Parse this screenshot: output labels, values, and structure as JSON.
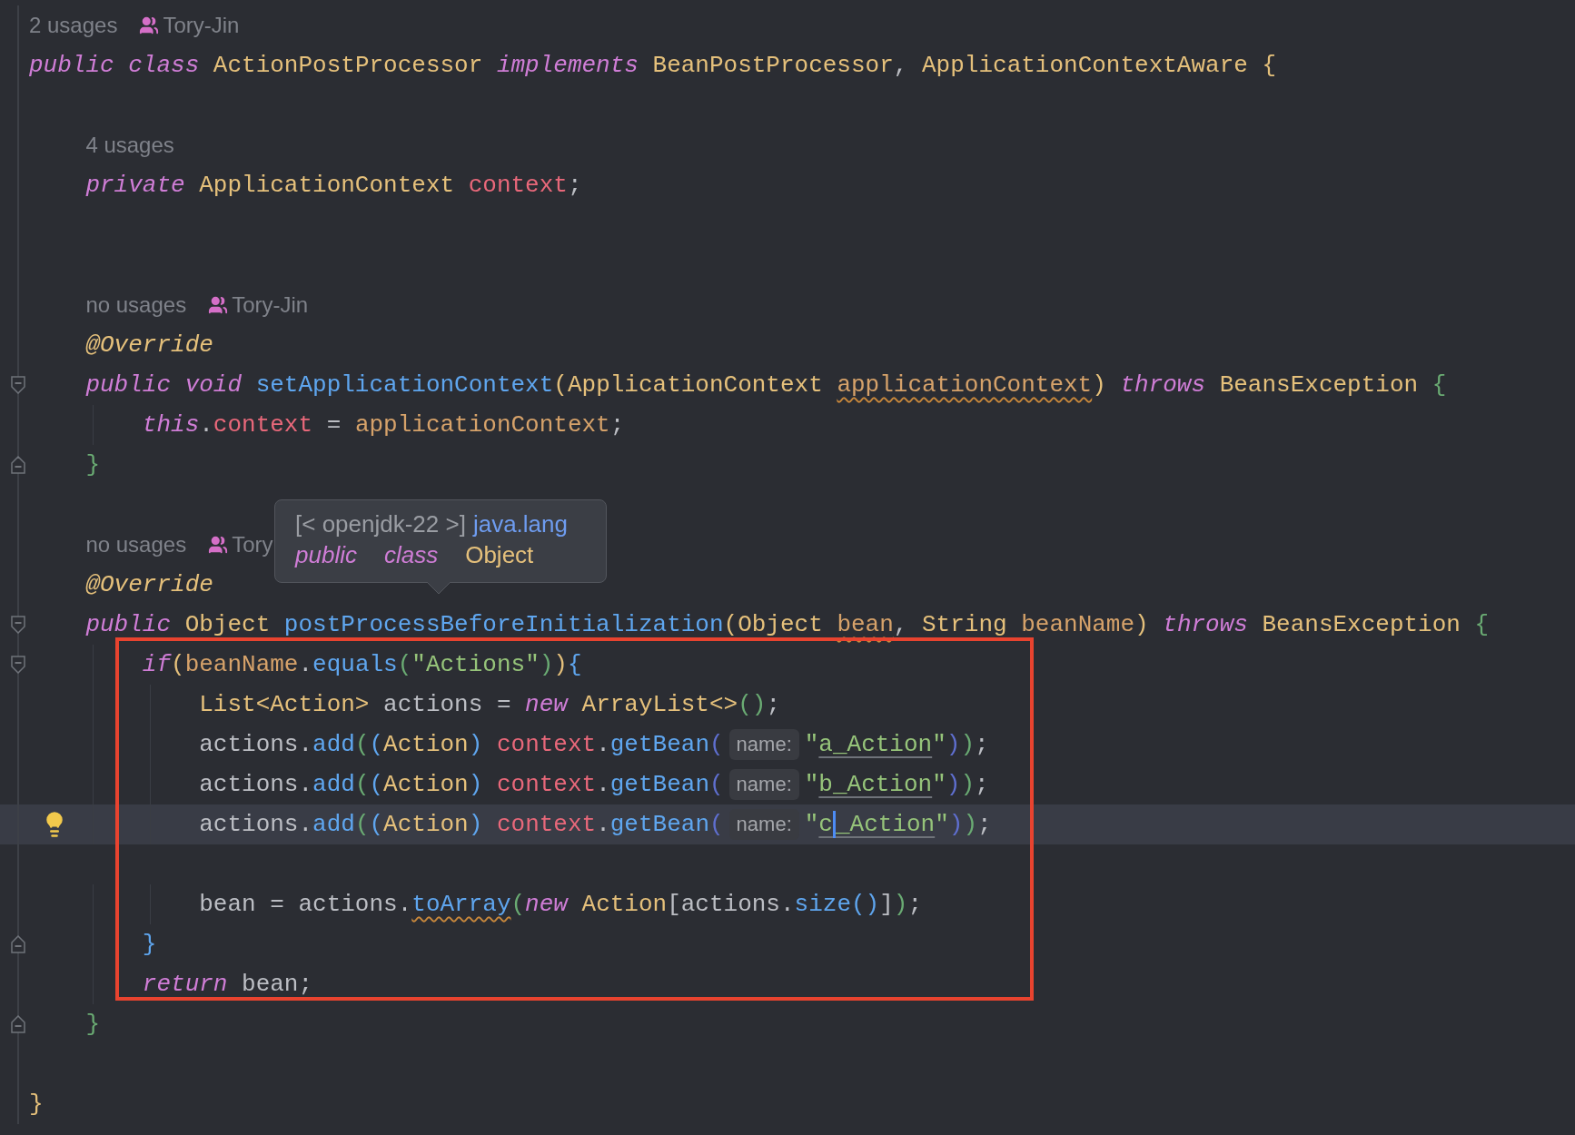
{
  "sections": [
    {
      "kind": "plain",
      "lines": [
        {
          "kind": "hint",
          "usages": "2 usages",
          "author": "Tory-Jin"
        },
        {
          "kind": "code",
          "tokens": [
            {
              "text": "public",
              "kind": "kw"
            },
            {
              "text": " class",
              "kind": "kw"
            },
            {
              "text": " ActionPostProcessor ",
              "kind": "type"
            },
            {
              "text": "implements",
              "kind": "kw"
            },
            {
              "text": " BeanPostProcessor",
              "kind": "type"
            },
            {
              "text": ", ",
              "kind": "plain"
            },
            {
              "text": "ApplicationContextAware ",
              "kind": "type"
            },
            {
              "text": "{",
              "kind": "bracket",
              "color": "#e5c07b"
            }
          ]
        },
        {
          "kind": "blank"
        },
        {
          "kind": "hint",
          "usages": "4 usages"
        },
        {
          "kind": "code",
          "tokens": [
            {
              "text": "    private",
              "kind": "kw"
            },
            {
              "text": " ApplicationContext ",
              "kind": "type"
            },
            {
              "text": "context",
              "kind": "field"
            },
            {
              "text": ";",
              "kind": "plain"
            }
          ]
        },
        {
          "kind": "blank"
        },
        {
          "kind": "blank"
        },
        {
          "kind": "hint",
          "usages": "no usages",
          "author": "Tory-Jin"
        },
        {
          "kind": "code",
          "tokens": [
            {
              "text": "    @Override",
              "kind": "annot"
            }
          ]
        },
        {
          "kind": "code",
          "fold_start": true,
          "tokens": [
            {
              "text": "    public",
              "kind": "kw"
            },
            {
              "text": " void",
              "kind": "kw"
            },
            {
              "text": " setApplicationContext",
              "kind": "fn"
            },
            {
              "text": "(",
              "kind": "bracket",
              "color": "#e5c07b"
            },
            {
              "text": "ApplicationContext ",
              "kind": "type"
            },
            {
              "text": "applicationContext",
              "kind": "param",
              "squiggly": true
            },
            {
              "text": ")",
              "kind": "bracket",
              "color": "#e5c07b"
            },
            {
              "text": " throws",
              "kind": "kw"
            },
            {
              "text": " BeansException ",
              "kind": "type"
            },
            {
              "text": "{",
              "kind": "bracket",
              "color": "#6aab73"
            }
          ]
        },
        {
          "kind": "code",
          "tokens": [
            {
              "text": "        this",
              "kind": "kw"
            },
            {
              "text": ".",
              "kind": "plain"
            },
            {
              "text": "context",
              "kind": "field"
            },
            {
              "text": " = ",
              "kind": "plain"
            },
            {
              "text": "applicationContext",
              "kind": "param"
            },
            {
              "text": ";",
              "kind": "plain"
            }
          ]
        },
        {
          "kind": "code",
          "fold_end": true,
          "tokens": [
            {
              "text": "    }",
              "kind": "bracket",
              "color": "#6aab73"
            }
          ]
        },
        {
          "kind": "blank"
        },
        {
          "kind": "hint",
          "usages": "no usages",
          "author": "Tory"
        },
        {
          "kind": "code",
          "tokens": [
            {
              "text": "    @Override",
              "kind": "annot"
            }
          ]
        },
        {
          "kind": "code",
          "fold_start": true,
          "tokens": [
            {
              "text": "    public",
              "kind": "kw"
            },
            {
              "text": " Object ",
              "kind": "type"
            },
            {
              "text": "postProcessBeforeInitialization",
              "kind": "fn"
            },
            {
              "text": "(",
              "kind": "bracket",
              "color": "#e5c07b"
            },
            {
              "text": "Object ",
              "kind": "type"
            },
            {
              "text": "bean",
              "kind": "param",
              "squiggly": true
            },
            {
              "text": ", ",
              "kind": "plain"
            },
            {
              "text": "String ",
              "kind": "type"
            },
            {
              "text": "beanName",
              "kind": "param"
            },
            {
              "text": ")",
              "kind": "bracket",
              "color": "#e5c07b"
            },
            {
              "text": " throws",
              "kind": "kw"
            },
            {
              "text": " BeansException ",
              "kind": "type"
            },
            {
              "text": "{",
              "kind": "bracket",
              "color": "#6aab73"
            }
          ]
        }
      ]
    },
    {
      "kind": "framed",
      "lines": [
        {
          "kind": "code",
          "fold_start": true,
          "tokens": [
            {
              "text": "        if",
              "kind": "kw"
            },
            {
              "text": "(",
              "kind": "bracket",
              "color": "#e5c07b"
            },
            {
              "text": "beanName",
              "kind": "param"
            },
            {
              "text": ".",
              "kind": "plain"
            },
            {
              "text": "equals",
              "kind": "fn"
            },
            {
              "text": "(",
              "kind": "bracket",
              "color": "#6aab73"
            },
            {
              "text": "\"Actions\"",
              "kind": "string"
            },
            {
              "text": ")",
              "kind": "bracket",
              "color": "#6aab73"
            },
            {
              "text": ")",
              "kind": "bracket",
              "color": "#e5c07b"
            },
            {
              "text": "{",
              "kind": "bracket",
              "color": "#5fa6ef"
            }
          ]
        },
        {
          "kind": "code",
          "tokens": [
            {
              "text": "            List<Action>",
              "kind": "type"
            },
            {
              "text": " actions = ",
              "kind": "plain"
            },
            {
              "text": "new",
              "kind": "kw"
            },
            {
              "text": " ArrayList<>",
              "kind": "type"
            },
            {
              "text": "()",
              "kind": "bracket",
              "color": "#6aab73"
            },
            {
              "text": ";",
              "kind": "plain"
            }
          ]
        },
        {
          "kind": "code",
          "tokens": [
            {
              "text": "            actions.",
              "kind": "plain"
            },
            {
              "text": "add",
              "kind": "fn"
            },
            {
              "text": "(",
              "kind": "bracket",
              "color": "#6aab73"
            },
            {
              "text": "(",
              "kind": "bracket",
              "color": "#5fa6ef"
            },
            {
              "text": "Action",
              "kind": "type"
            },
            {
              "text": ")",
              "kind": "bracket",
              "color": "#5fa6ef"
            },
            {
              "text": " context",
              "kind": "field"
            },
            {
              "text": ".",
              "kind": "plain"
            },
            {
              "text": "getBean",
              "kind": "fn"
            },
            {
              "text": "(",
              "kind": "bracket",
              "color": "#5f6fd0"
            },
            {
              "text": "name:",
              "kind": "inlay"
            },
            {
              "text": "\"",
              "kind": "string"
            },
            {
              "text": "a_Action",
              "kind": "string",
              "underlined": true
            },
            {
              "text": "\"",
              "kind": "string"
            },
            {
              "text": ")",
              "kind": "bracket",
              "color": "#5f6fd0"
            },
            {
              "text": ")",
              "kind": "bracket",
              "color": "#6aab73"
            },
            {
              "text": ";",
              "kind": "plain"
            }
          ]
        },
        {
          "kind": "code",
          "tokens": [
            {
              "text": "            actions.",
              "kind": "plain"
            },
            {
              "text": "add",
              "kind": "fn"
            },
            {
              "text": "(",
              "kind": "bracket",
              "color": "#6aab73"
            },
            {
              "text": "(",
              "kind": "bracket",
              "color": "#5fa6ef"
            },
            {
              "text": "Action",
              "kind": "type"
            },
            {
              "text": ")",
              "kind": "bracket",
              "color": "#5fa6ef"
            },
            {
              "text": " context",
              "kind": "field"
            },
            {
              "text": ".",
              "kind": "plain"
            },
            {
              "text": "getBean",
              "kind": "fn"
            },
            {
              "text": "(",
              "kind": "bracket",
              "color": "#5f6fd0"
            },
            {
              "text": "name:",
              "kind": "inlay"
            },
            {
              "text": "\"",
              "kind": "string"
            },
            {
              "text": "b_Action",
              "kind": "string",
              "underlined": true
            },
            {
              "text": "\"",
              "kind": "string"
            },
            {
              "text": ")",
              "kind": "bracket",
              "color": "#5f6fd0"
            },
            {
              "text": ")",
              "kind": "bracket",
              "color": "#6aab73"
            },
            {
              "text": ";",
              "kind": "plain"
            }
          ]
        },
        {
          "kind": "code",
          "current": true,
          "intention": true,
          "tokens": [
            {
              "text": "            actions.",
              "kind": "plain"
            },
            {
              "text": "add",
              "kind": "fn"
            },
            {
              "text": "(",
              "kind": "bracket",
              "color": "#6aab73"
            },
            {
              "text": "(",
              "kind": "bracket",
              "color": "#5fa6ef"
            },
            {
              "text": "Action",
              "kind": "type"
            },
            {
              "text": ")",
              "kind": "bracket",
              "color": "#5fa6ef"
            },
            {
              "text": " context",
              "kind": "field"
            },
            {
              "text": ".",
              "kind": "plain"
            },
            {
              "text": "getBean",
              "kind": "fn"
            },
            {
              "text": "(",
              "kind": "bracket",
              "color": "#5f6fd0"
            },
            {
              "text": "name:",
              "kind": "inlay"
            },
            {
              "text": "\"",
              "kind": "string"
            },
            {
              "text": "c",
              "kind": "string",
              "underlined": true
            },
            {
              "kind": "caret"
            },
            {
              "text": "_Action",
              "kind": "string",
              "underlined": true
            },
            {
              "text": "\"",
              "kind": "string"
            },
            {
              "text": ")",
              "kind": "bracket",
              "color": "#5f6fd0"
            },
            {
              "text": ")",
              "kind": "bracket",
              "color": "#6aab73"
            },
            {
              "text": ";",
              "kind": "plain"
            }
          ]
        },
        {
          "kind": "blank"
        },
        {
          "kind": "code",
          "tokens": [
            {
              "text": "            bean = actions.",
              "kind": "plain"
            },
            {
              "text": "toArray",
              "kind": "fn",
              "squiggly": true
            },
            {
              "text": "(",
              "kind": "bracket",
              "color": "#6aab73"
            },
            {
              "text": "new",
              "kind": "kw"
            },
            {
              "text": " Action",
              "kind": "type"
            },
            {
              "text": "[actions.",
              "kind": "plain"
            },
            {
              "text": "size",
              "kind": "fn"
            },
            {
              "text": "()",
              "kind": "bracket",
              "color": "#5fa6ef"
            },
            {
              "text": "]",
              "kind": "plain"
            },
            {
              "text": ")",
              "kind": "bracket",
              "color": "#6aab73"
            },
            {
              "text": ";",
              "kind": "plain"
            }
          ]
        },
        {
          "kind": "code",
          "fold_end": true,
          "tokens": [
            {
              "text": "        }",
              "kind": "bracket",
              "color": "#5fa6ef"
            }
          ]
        },
        {
          "kind": "code",
          "tokens": [
            {
              "text": "        return",
              "kind": "kw"
            },
            {
              "text": " bean;",
              "kind": "plain"
            }
          ]
        }
      ]
    },
    {
      "kind": "plain",
      "lines": [
        {
          "kind": "code",
          "fold_end": true,
          "tokens": [
            {
              "text": "    }",
              "kind": "bracket",
              "color": "#6aab73"
            }
          ]
        },
        {
          "kind": "blank"
        },
        {
          "kind": "code",
          "tokens": [
            {
              "text": "}",
              "kind": "bracket",
              "color": "#e5c07b"
            }
          ]
        }
      ]
    }
  ],
  "tooltip": {
    "origin": "[< openjdk-22 >]",
    "package": "java.lang",
    "declaration": [
      {
        "text": "public",
        "kind": "kw"
      },
      {
        "text": "class",
        "kind": "kw"
      },
      {
        "text": "Object",
        "kind": "type"
      }
    ]
  }
}
